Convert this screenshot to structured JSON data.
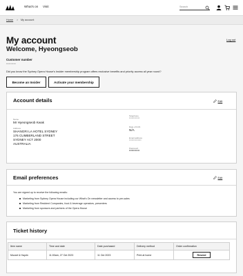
{
  "header": {
    "logo_icon": "opera-house-sails-icon",
    "nav": [
      "What's on",
      "Visit"
    ],
    "search_placeholder": "Search",
    "icons": [
      "search-icon",
      "user-icon",
      "cart-icon",
      "menu-icon"
    ]
  },
  "breadcrumb": {
    "home": "Home",
    "separator": ">",
    "current": "My account"
  },
  "page": {
    "title": "My account",
    "welcome": "Welcome, Hyeongseob",
    "logout": "Log out",
    "customer_number_label": "Customer number",
    "customer_number_value": "••••••••",
    "intro": "Did you know the Sydney Opera House's Insider membership program offers exclusive benefits and priority access all year round?",
    "buttons": {
      "insider": "Become an Insider",
      "activate": "Activate your membership"
    }
  },
  "account_details": {
    "title": "Account details",
    "edit": "Edit",
    "name_label": "Name",
    "name": "Mr Hyeongseob Kwak",
    "address_label": "Address",
    "address_lines": [
      "SHANGRI LA HOTEL SYDNEY",
      "176 CUMBERLAND STREET",
      "SYDNEY ACT 2000",
      "AUSTRALIA"
    ],
    "telephone_label": "Telephone",
    "telephone": "••••••••••••",
    "dob_label": "Date of birth",
    "dob": "N/A",
    "email_label": "Email address",
    "email": "••••••••••••••",
    "password_label": "Password",
    "password": "••••••••••••"
  },
  "email_preferences": {
    "title": "Email preferences",
    "edit": "Edit",
    "intro": "You are signed up to receive the following emails:",
    "items": [
      "Marketing from Sydney Opera House including our What's On newsletter and access to pre-sales",
      "Marketing from Resident Companies, food & beverage operators, presenters",
      "Marketing from sponsors and partners of the Opera House"
    ]
  },
  "ticket_history": {
    "title": "Ticket history",
    "columns": [
      "Item name",
      "Time and date",
      "Date purchased",
      "Delivery method",
      "Order confirmation"
    ],
    "rows": [
      {
        "item": "Mozart & Haydn",
        "time": "11:00am, 27 Oct 2023",
        "purchased": "11 Oct 2023",
        "delivery": "Print at home",
        "action": "Resend"
      }
    ]
  }
}
